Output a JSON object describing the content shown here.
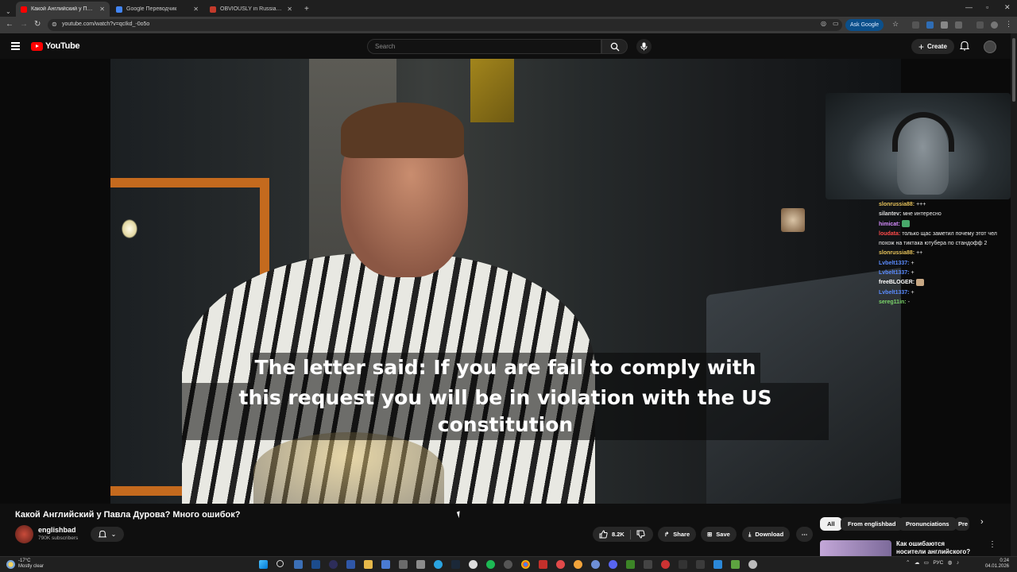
{
  "browser": {
    "tabs": [
      {
        "label": "Какой Английский у Павла Ду...",
        "color": "#ff0000",
        "active": true
      },
      {
        "label": "Google Переводчик",
        "color": "#4285f4",
        "active": false
      },
      {
        "label": "OBVIOUSLY in Russian - Cambr...",
        "color": "#c43a2b",
        "active": false
      }
    ],
    "url": "youtube.com/watch?v=qcIkd_-0o5o",
    "ask_google": "Ask Google"
  },
  "yt": {
    "logo": "YouTube",
    "search_placeholder": "Search",
    "create_label": "Create"
  },
  "video": {
    "subtitle_line1": "The letter said: If you are fail to comply with",
    "subtitle_line2": "this request you will be in violation with the US constitution"
  },
  "chat": [
    {
      "user": "slonrussia88:",
      "text": "+++",
      "color": "#e6c25a"
    },
    {
      "user": "silantev:",
      "text": "мне интересно",
      "color": "#dddddd"
    },
    {
      "user": "himicat:",
      "text": "",
      "color": "#d58cff",
      "emote": "#48a86a"
    },
    {
      "user": "loudata:",
      "text": "только щас заметил почему этот чел похож на тиктака ютубера по стандофф 2",
      "color": "#ff4a4a",
      "wrap": true
    },
    {
      "user": "slonrussia88:",
      "text": "++",
      "color": "#e6c25a"
    },
    {
      "user": "Lvbelt1337:",
      "text": "+",
      "color": "#5b8cff"
    },
    {
      "user": "Lvbelt1337:",
      "text": "+",
      "color": "#5b8cff"
    },
    {
      "user": "freeBLOGER:",
      "text": "",
      "color": "#ffffff",
      "emote": "#c8a884"
    },
    {
      "user": "Lvbelt1337:",
      "text": "+",
      "color": "#5b8cff"
    },
    {
      "user": "sereg11in:",
      "text": "-",
      "color": "#7bd66a"
    }
  ],
  "below": {
    "title": "Какой Английский у Павла Дурова? Много ошибок?",
    "channel": "englishbad",
    "subscribers": "790K subscribers",
    "likes": "8.2K",
    "share": "Share",
    "save": "Save",
    "download": "Download",
    "chips": [
      "All",
      "From englishbad",
      "Pronunciations",
      "Pre"
    ],
    "rec_title": "Как ошибаются носители английского?"
  },
  "taskbar": {
    "temp": "-17°C",
    "weather": "Mostly clear",
    "lang": "РУС",
    "time": "0:24",
    "date": "04.01.2026"
  }
}
